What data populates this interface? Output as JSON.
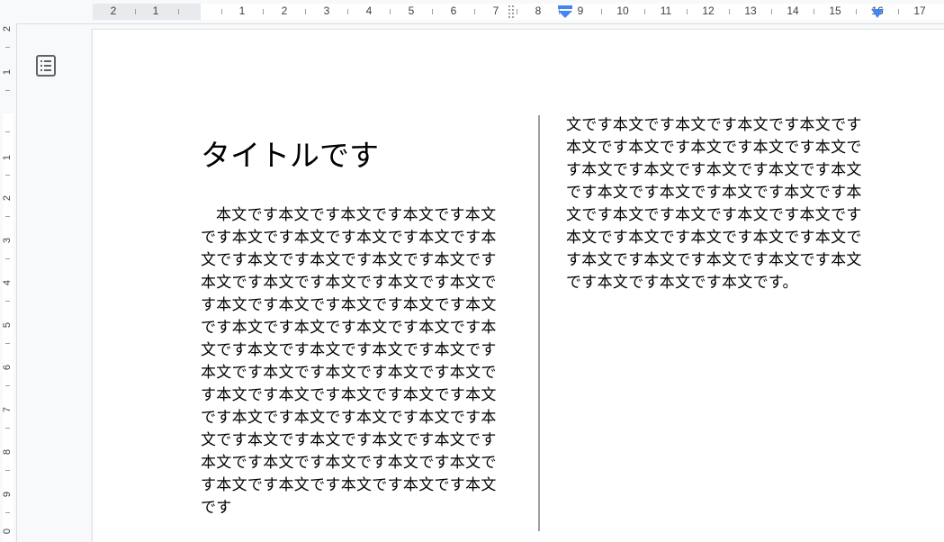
{
  "document": {
    "title": "タイトルです",
    "column1_text": "本文です本文です本文です本文です本文です本文です本文です本文です本文です本文です本文です本文です本文です本文です本文です本文です本文です本文です本文です本文です本文です本文です本文です本文です本文です本文です本文です本文です本文です本文です本文です本文です本文です本文です本文です本文です本文です本文です本文です本文です本文です本文です本文です本文です本文です本文です本文です本文です本文です本文です本文です本文です本文です本文です本文です本文です本文です本文です本文です本文です本文です本文です",
    "column2_text": "文です本文です本文です本文です本文です本文です本文です本文です本文です本文です本文です本文です本文です本文です本文です本文です本文です本文です本文です本文です本文です本文です本文です本文です本文です本文です本文です本文です本文です本文です本文です本文です本文です本文です本文です本文です本文です。"
  },
  "ruler": {
    "left_margin_numbers": [
      "2",
      "1"
    ],
    "numbers": [
      "1",
      "2",
      "3",
      "4",
      "5",
      "6",
      "7",
      "8",
      "9",
      "10",
      "11",
      "12",
      "13",
      "14",
      "15",
      "16",
      "17"
    ],
    "vertical_numbers": [
      "2",
      "1",
      "1",
      "2",
      "3",
      "4",
      "5",
      "6",
      "7",
      "8",
      "9",
      "0"
    ]
  },
  "icons": {
    "outline": "document-outline-icon",
    "indent_marker": "indent-marker-icon",
    "right_indent": "right-indent-icon"
  },
  "colors": {
    "accent": "#4285f4",
    "page": "#ffffff",
    "ruler_bg": "#f8f9fa"
  }
}
